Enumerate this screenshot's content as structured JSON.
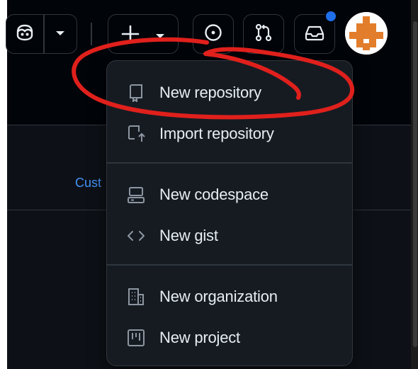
{
  "header": {
    "create_plus": "+",
    "icons": {
      "copilot": "copilot-icon",
      "caret": "triangle-down-icon",
      "create": "plus-icon",
      "issues": "issue-opened-icon",
      "pulls": "git-pull-request-icon",
      "inbox": "inbox-icon",
      "avatar": "identicon-avatar"
    },
    "notification_dot_color": "#1f6feb"
  },
  "page": {
    "partial_link": "Cust",
    "link_color": "#4493f8"
  },
  "menu": {
    "items": [
      {
        "label": "New repository",
        "icon": "repo-icon"
      },
      {
        "label": "Import repository",
        "icon": "repo-push-icon"
      },
      {
        "label": "New codespace",
        "icon": "codespaces-icon"
      },
      {
        "label": "New gist",
        "icon": "code-icon"
      },
      {
        "label": "New organization",
        "icon": "organization-icon"
      },
      {
        "label": "New project",
        "icon": "project-icon"
      }
    ]
  },
  "annotation": {
    "color": "#e0201c",
    "target": "New repository"
  }
}
